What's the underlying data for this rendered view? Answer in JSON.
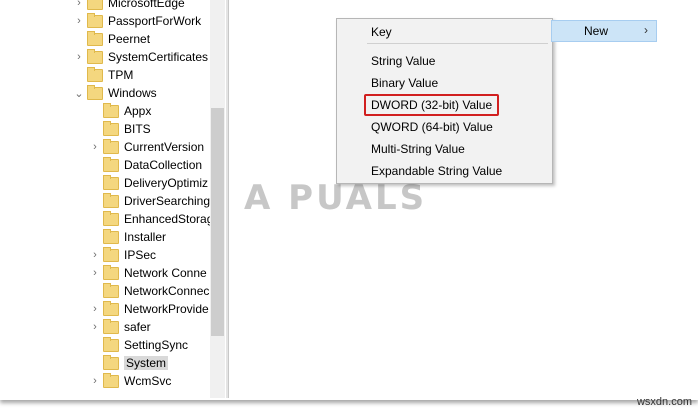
{
  "tree": {
    "items": [
      {
        "label": "MicrosoftEdge",
        "expander": true,
        "indent": 0
      },
      {
        "label": "PassportForWork",
        "expander": true,
        "indent": 0
      },
      {
        "label": "Peernet",
        "expander": false,
        "indent": 0
      },
      {
        "label": "SystemCertificates",
        "expander": true,
        "indent": 0
      },
      {
        "label": "TPM",
        "expander": false,
        "indent": 0
      },
      {
        "label": "Windows",
        "expander": "open",
        "indent": 0
      },
      {
        "label": "Appx",
        "expander": false,
        "indent": 1
      },
      {
        "label": "BITS",
        "expander": false,
        "indent": 1
      },
      {
        "label": "CurrentVersion",
        "expander": true,
        "indent": 1
      },
      {
        "label": "DataCollection",
        "expander": false,
        "indent": 1
      },
      {
        "label": "DeliveryOptimiz",
        "expander": false,
        "indent": 1
      },
      {
        "label": "DriverSearching",
        "expander": false,
        "indent": 1
      },
      {
        "label": "EnhancedStorag",
        "expander": false,
        "indent": 1
      },
      {
        "label": "Installer",
        "expander": false,
        "indent": 1
      },
      {
        "label": "IPSec",
        "expander": true,
        "indent": 1
      },
      {
        "label": "Network Conne",
        "expander": true,
        "indent": 1
      },
      {
        "label": "NetworkConnec",
        "expander": false,
        "indent": 1
      },
      {
        "label": "NetworkProvide",
        "expander": true,
        "indent": 1
      },
      {
        "label": "safer",
        "expander": true,
        "indent": 1
      },
      {
        "label": "SettingSync",
        "expander": false,
        "indent": 1
      },
      {
        "label": "System",
        "expander": false,
        "indent": 1,
        "selected": true
      },
      {
        "label": "WcmSvc",
        "expander": true,
        "indent": 1
      }
    ]
  },
  "context_menu": {
    "items": [
      {
        "label": "Key"
      },
      {
        "label": "String Value"
      },
      {
        "label": "Binary Value"
      },
      {
        "label": "DWORD (32-bit) Value",
        "highlighted": true
      },
      {
        "label": "QWORD (64-bit) Value"
      },
      {
        "label": "Multi-String Value"
      },
      {
        "label": "Expandable String Value"
      }
    ],
    "highlight_color": "#d11f1f"
  },
  "submenu_parent": {
    "label": "New",
    "arrow": "›",
    "background": "#cce4f7"
  },
  "watermark": {
    "text": "A PUALS"
  },
  "site_mark": {
    "text": "wsxdn.com"
  },
  "icons": {
    "expander_collapsed": "›",
    "expander_open": "⌄",
    "folder": "folder-icon"
  }
}
